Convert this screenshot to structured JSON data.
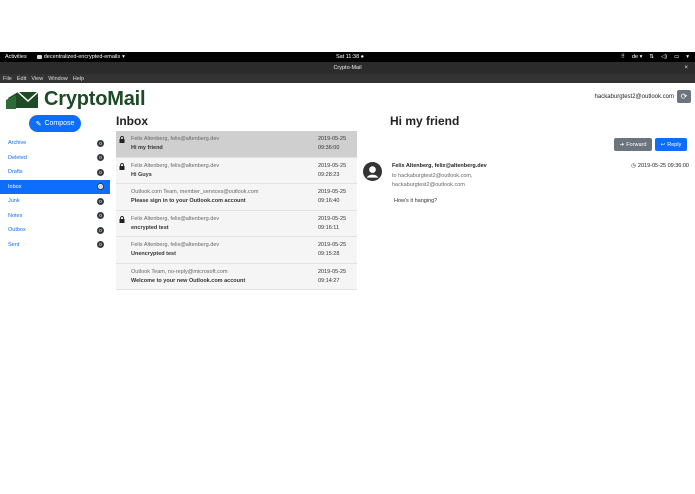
{
  "system": {
    "activities": "Activities",
    "app_menu": "decentralized-encrypted-emails",
    "clock": "Sat 11:38",
    "keyboard": "de"
  },
  "window": {
    "title": "Crypto-Mail",
    "close": "×"
  },
  "menu": [
    "File",
    "Edit",
    "View",
    "Window",
    "Help"
  ],
  "brand": {
    "name": "CryptoMail",
    "color": "#1e4a26"
  },
  "account": {
    "email": "hackaburgtest2@outlook.com",
    "refresh_icon": "refresh-icon"
  },
  "compose_label": "Compose",
  "folders": [
    {
      "label": "Archive",
      "count": "0",
      "active": false
    },
    {
      "label": "Deleted",
      "count": "0",
      "active": false
    },
    {
      "label": "Drafts",
      "count": "0",
      "active": false
    },
    {
      "label": "Inbox",
      "count": "0",
      "active": true
    },
    {
      "label": "Junk",
      "count": "0",
      "active": false
    },
    {
      "label": "Notes",
      "count": "0",
      "active": false
    },
    {
      "label": "Outbox",
      "count": "0",
      "active": false
    },
    {
      "label": "Sent",
      "count": "0",
      "active": false
    }
  ],
  "inbox": {
    "title": "Inbox",
    "messages": [
      {
        "from": "Felix Altenberg, felix@altenberg.dev",
        "subject": "Hi my friend",
        "date": "2019-05-25",
        "time": "09:36:00",
        "encrypted": true,
        "selected": true
      },
      {
        "from": "Felix Altenberg, felix@altenberg.dev",
        "subject": "Hi Guys",
        "date": "2019-05-25",
        "time": "09:28:23",
        "encrypted": true,
        "selected": false
      },
      {
        "from": "Outlook.com Team, member_services@outlook.com",
        "subject": "Please sign in to your Outlook.com account",
        "date": "2019-05-25",
        "time": "09:16:40",
        "encrypted": false,
        "selected": false
      },
      {
        "from": "Felix Altenberg, felix@altenberg.dev",
        "subject": "encrypted test",
        "date": "2019-05-25",
        "time": "09:16:11",
        "encrypted": true,
        "selected": false
      },
      {
        "from": "Felix Altenberg, felix@altenberg.dev",
        "subject": "Unencrypted test",
        "date": "2019-05-25",
        "time": "09:15:28",
        "encrypted": false,
        "selected": false
      },
      {
        "from": "Outlook Team, no-reply@microsoft.com",
        "subject": "Welcome to your new Outlook.com account",
        "date": "2019-05-25",
        "time": "09:14:27",
        "encrypted": false,
        "selected": false
      }
    ]
  },
  "detail": {
    "subject": "Hi my friend",
    "forward_label": "Forward",
    "reply_label": "Reply",
    "sender": "Felix Altenberg, felix@altenberg.dev",
    "recipients": "to hackaburgtest2@outlook.com, hackaburgtest2@outlook.com",
    "timestamp": "2019-05-25 09:36:00",
    "body": "How's it hanging?"
  },
  "colors": {
    "primary": "#0d6efd",
    "secondary": "#6c757d",
    "dark": "#343a40"
  }
}
